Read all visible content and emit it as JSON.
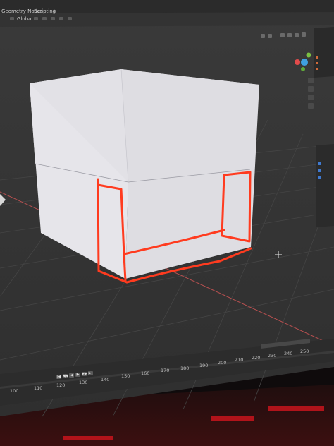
{
  "window": {
    "workspace_tabs": [
      "Geometry Nodes",
      "Scripting"
    ],
    "add_tab_label": "+"
  },
  "viewport_header": {
    "orientation_label": "Global"
  },
  "timeline": {
    "frame_ticks": [
      "100",
      "110",
      "120",
      "130",
      "140",
      "150",
      "160",
      "170",
      "180",
      "190",
      "200",
      "210",
      "220",
      "230",
      "240",
      "250"
    ]
  },
  "colors": {
    "viewport_bg": "#3a3a3a",
    "cube_light": "#ecebee",
    "cube_side": "#dcdbe0",
    "annotation": "#ff3b1f",
    "x_axis": "#b85050",
    "bezel": "#0c0a0b"
  }
}
